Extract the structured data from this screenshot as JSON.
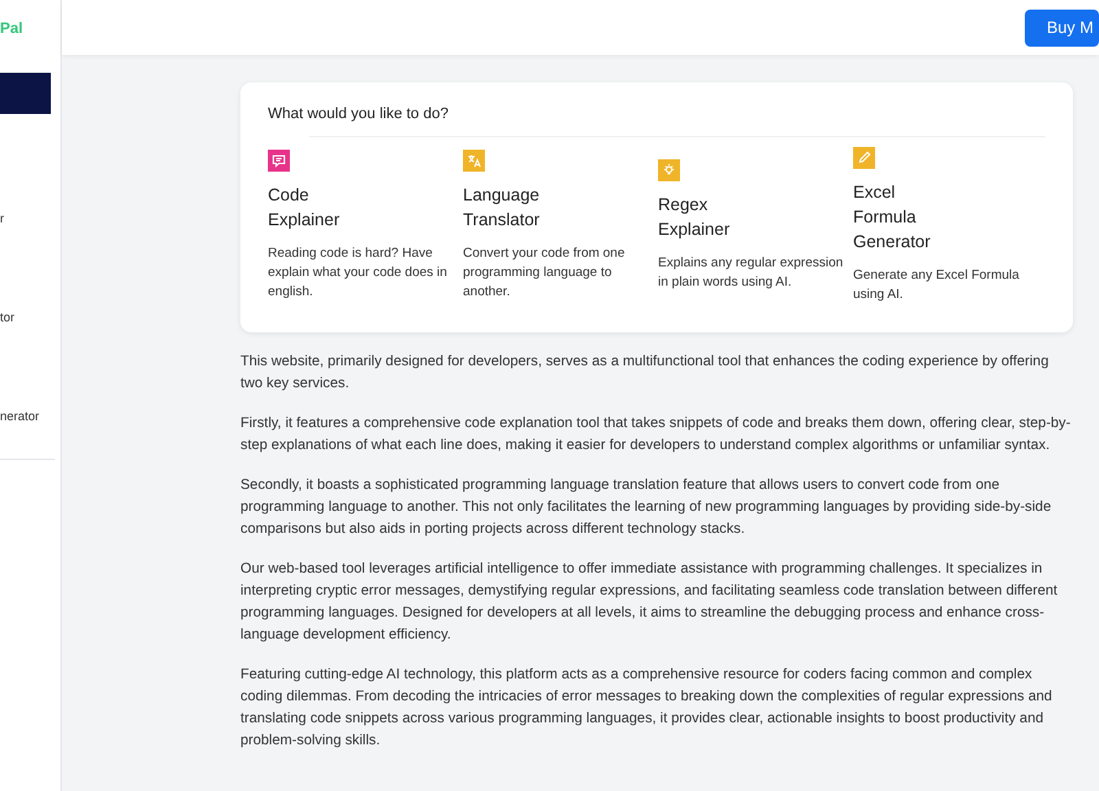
{
  "sidebar": {
    "logo": "Pal",
    "items": [
      {
        "selected": true
      },
      {
        "label": "r",
        "selected": false
      },
      {
        "label": "tor",
        "selected": false
      },
      {
        "label": "nerator",
        "selected": false
      }
    ]
  },
  "header": {
    "button": "Buy M"
  },
  "card": {
    "title": "What would you like to do?",
    "services": [
      {
        "kind": "chat",
        "color": "#e8338a",
        "title": [
          "Code",
          "Explainer"
        ],
        "description": "Reading code is hard? Have explain what your code does in english."
      },
      {
        "kind": "translate",
        "color": "#f0b429",
        "title": [
          "Language",
          "Translator"
        ],
        "description": "Convert your code from one programming language to another."
      },
      {
        "kind": "bulb",
        "color": "#f0b429",
        "title": [
          "Regex",
          "Explainer"
        ],
        "description": "Explains any regular expression in plain words using AI."
      },
      {
        "kind": "pencil",
        "color": "#f0b429",
        "title": [
          "Excel",
          "Formula",
          "Generator"
        ],
        "description": "Generate any Excel Formula using AI."
      }
    ]
  },
  "paragraphs": [
    "This website, primarily designed for developers, serves as a multifunctional tool that enhances the coding experience by offering two key services.",
    "Firstly, it features a comprehensive code explanation tool that takes snippets of code and breaks them down, offering clear, step-by-step explanations of what each line does, making it easier for developers to understand complex algorithms or unfamiliar syntax.",
    "Secondly, it boasts a sophisticated programming language translation feature that allows users to convert code from one programming language to another. This not only facilitates the learning of new programming languages by providing side-by-side comparisons but also aids in porting projects across different technology stacks.",
    "Our web-based tool leverages artificial intelligence to offer immediate assistance with programming challenges. It specializes in interpreting cryptic error messages, demystifying regular expressions, and facilitating seamless code translation between different programming languages. Designed for developers at all levels, it aims to streamline the debugging process and enhance cross-language development efficiency.",
    "Featuring cutting-edge AI technology, this platform acts as a comprehensive resource for coders facing common and complex coding dilemmas. From decoding the intricacies of error messages to breaking down the complexities of regular expressions and translating code snippets across various programming languages, it provides clear, actionable insights to boost productivity and problem-solving skills."
  ]
}
